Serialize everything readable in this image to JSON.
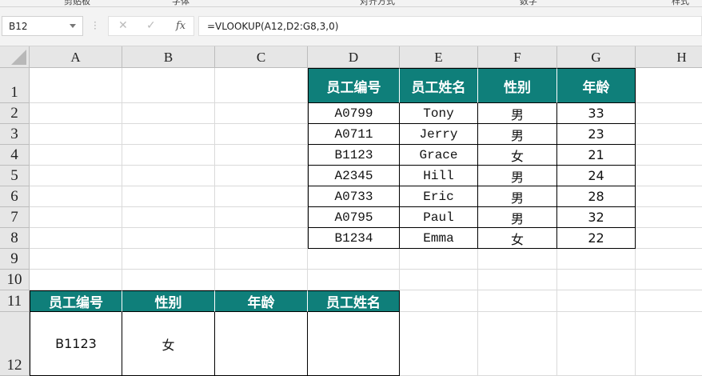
{
  "ribbon_groups": [
    "剪贴板",
    "字体",
    "对齐方式",
    "数字",
    "样式"
  ],
  "name_box": "B12",
  "formula_buttons": {
    "cancel": "✕",
    "enter": "✓",
    "fx": "fx"
  },
  "formula": "=VLOOKUP(A12,D2:G8,3,0)",
  "columns": [
    "A",
    "B",
    "C",
    "D",
    "E",
    "F",
    "G",
    "H"
  ],
  "rows": [
    "1",
    "2",
    "3",
    "4",
    "5",
    "6",
    "7",
    "8",
    "9",
    "10",
    "11",
    "12"
  ],
  "table1": {
    "headers": [
      "员工编号",
      "员工姓名",
      "性别",
      "年龄"
    ],
    "rows": [
      [
        "A0799",
        "Tony",
        "男",
        "33"
      ],
      [
        "A0711",
        "Jerry",
        "男",
        "23"
      ],
      [
        "B1123",
        "Grace",
        "女",
        "21"
      ],
      [
        "A2345",
        "Hill",
        "男",
        "24"
      ],
      [
        "A0733",
        "Eric",
        "男",
        "28"
      ],
      [
        "A0795",
        "Paul",
        "男",
        "32"
      ],
      [
        "B1234",
        "Emma",
        "女",
        "22"
      ]
    ]
  },
  "table2": {
    "headers": [
      "员工编号",
      "性别",
      "年龄",
      "员工姓名"
    ],
    "rows": [
      [
        "B1123",
        "女",
        "",
        ""
      ]
    ]
  },
  "colors": {
    "header_fill": "#0f7f7a"
  }
}
